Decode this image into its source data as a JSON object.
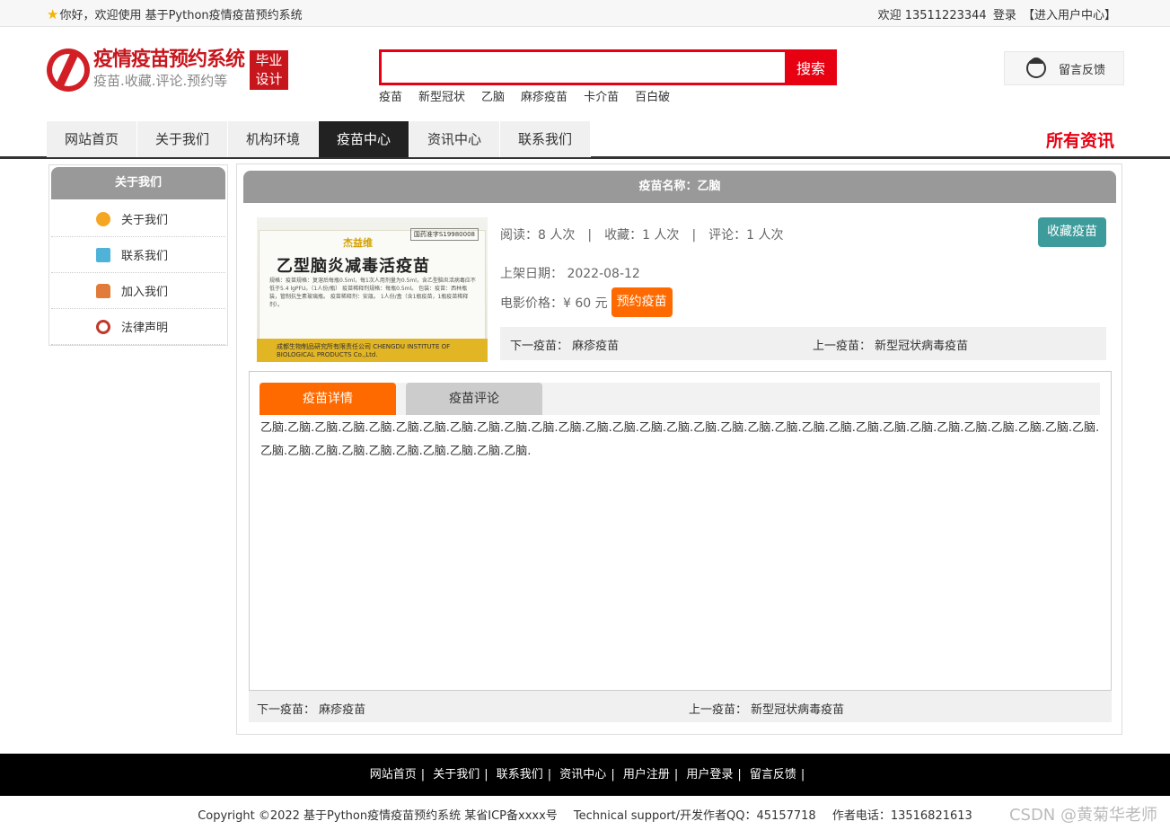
{
  "topbar": {
    "welcome": "你好，欢迎使用 基于Python疫情疫苗预约系统",
    "user_greeting": "欢迎 13511223344",
    "login": "登录",
    "user_center": "【进入用户中心】"
  },
  "logo": {
    "title": "疫情疫苗预约系统",
    "subtitle": "疫苗.收藏.评论.预约等",
    "badge_line1": "毕业",
    "badge_line2": "设计"
  },
  "search": {
    "value": "",
    "button": "搜索",
    "hotwords": [
      "疫苗",
      "新型冠状",
      "乙脑",
      "麻疹疫苗",
      "卡介苗",
      "百白破"
    ]
  },
  "feedback": {
    "label": "留言反馈"
  },
  "nav": {
    "items": [
      "网站首页",
      "关于我们",
      "机构环境",
      "疫苗中心",
      "资讯中心",
      "联系我们"
    ],
    "active_index": 3,
    "all_news": "所有资讯"
  },
  "sidebar": {
    "title": "关于我们",
    "items": [
      {
        "label": "关于我们",
        "icon": "info-icon",
        "color": "#f5a623"
      },
      {
        "label": "联系我们",
        "icon": "clipboard-icon",
        "color": "#4fb3d9"
      },
      {
        "label": "加入我们",
        "icon": "lock-icon",
        "color": "#e07b39"
      },
      {
        "label": "法律声明",
        "icon": "power-icon",
        "color": "#c0392b"
      }
    ]
  },
  "vaccine": {
    "title": "疫苗名称：乙脑",
    "image": {
      "approval": "国药准字S19980008",
      "brand": "杰益维",
      "name": "乙型脑炎减毒活疫苗",
      "spec": "规格：疫苗规格：复溶后每瓶0.5ml，每1次人用剂量为0.5ml，含乙型脑炎活病毒应不低于5.4 lgPFU。（1人份/瓶） 疫苗稀释剂规格：每瓶0.5ml。 包装：疫苗：西林瓶装，管制抗生素玻璃瓶。 疫苗稀释剂：安瓿。 1人份/盒（含1瓶疫苗，1瓶疫苗稀释剂）。",
      "maker": "成都生物制品研究所有限责任公司 CHENGDU INSTITUTE OF BIOLOGICAL PRODUCTS Co.,Ltd."
    },
    "reads": "阅读：8 人次",
    "favorites": "收藏：1 人次",
    "comments": "评论：1 人次",
    "fav_button": "收藏疫苗",
    "date_label": "上架日期：",
    "date": "2022-08-12",
    "price_label": "电影价格：¥ 60 元",
    "book_button": "预约疫苗",
    "next_label": "下一疫苗：",
    "next": "麻疹疫苗",
    "prev_label": "上一疫苗：",
    "prev": "新型冠状病毒疫苗",
    "tab_detail": "疫苗详情",
    "tab_comments": "疫苗评论",
    "detail_text": "乙脑.乙脑.乙脑.乙脑.乙脑.乙脑.乙脑.乙脑.乙脑.乙脑.乙脑.乙脑.乙脑.乙脑.乙脑.乙脑.乙脑.乙脑.乙脑.乙脑.乙脑.乙脑.乙脑.乙脑.乙脑.乙脑.乙脑.乙脑.乙脑.乙脑.乙脑.乙脑.乙脑.乙脑.乙脑.乙脑.乙脑.乙脑.乙脑.乙脑.乙脑."
  },
  "footer": {
    "links": [
      "网站首页",
      "关于我们",
      "联系我们",
      "资讯中心",
      "用户注册",
      "用户登录",
      "留言反馈"
    ],
    "copyright": "Copyright ©2022 基于Python疫情疫苗预约系统 某省ICP备xxxx号",
    "support": "Technical support/开发作者QQ：45157718",
    "phone": "作者电话：13516821613",
    "watermark": "CSDN @黄菊华老师"
  }
}
